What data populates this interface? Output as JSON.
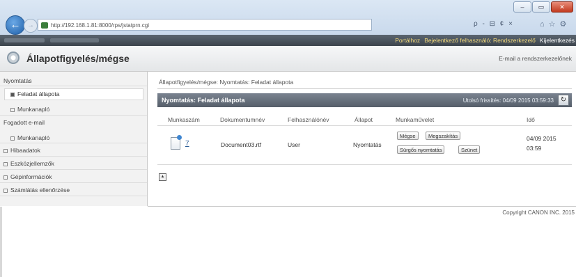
{
  "browser": {
    "url": "http://192.168.1.81:8000/rps/jstatprn.cgi",
    "addr_tools": "ρ - ⊟ ¢ ×",
    "window_controls": [
      "–",
      "▭",
      "✕"
    ]
  },
  "topbar": {
    "portal": "Portálhoz",
    "user": "Bejelentkező felhasználó: Rendszerkezelő",
    "logout": "Kijelentkezés"
  },
  "header": {
    "title": "Állapotfigyelés/mégse",
    "mail_link": "E-mail a rendszerkezelőnek"
  },
  "sidebar": {
    "items": [
      {
        "label": "Nyomtatás",
        "level": 0
      },
      {
        "label": "Feladat állapota",
        "level": 1,
        "selected": true
      },
      {
        "label": "Munkanapló",
        "level": 1
      },
      {
        "label": "Fogadott e-mail",
        "level": 0
      },
      {
        "label": "Munkanapló",
        "level": 1
      },
      {
        "label": "Hibaadatok",
        "level": 0
      },
      {
        "label": "Eszközjellemzők",
        "level": 0
      },
      {
        "label": "Gépinformációk",
        "level": 0
      },
      {
        "label": "Számlálás ellenőrzése",
        "level": 0
      }
    ]
  },
  "main": {
    "breadcrumb": "Állapotfigyelés/mégse: Nyomtatás: Feladat állapota",
    "panel_title": "Nyomtatás: Feladat állapota",
    "last_update": "Utolsó frissítés: 04/09 2015 03:59:33",
    "columns": [
      "Munkaszám",
      "Dokumentumnév",
      "Felhasználónév",
      "Állapot",
      "Munkaművelet",
      "Idő"
    ],
    "rows": [
      {
        "job_number": "7",
        "document": "Document03.rtf",
        "user": "User",
        "status": "Nyomtatás",
        "actions": [
          "Mégse",
          "Megszakítás",
          "Sürgős nyomtatás",
          "Szünet"
        ],
        "time_line1": "04/09 2015",
        "time_line2": "03:59"
      }
    ]
  },
  "footer": {
    "copyright": "Copyright CANON INC. 2015"
  }
}
